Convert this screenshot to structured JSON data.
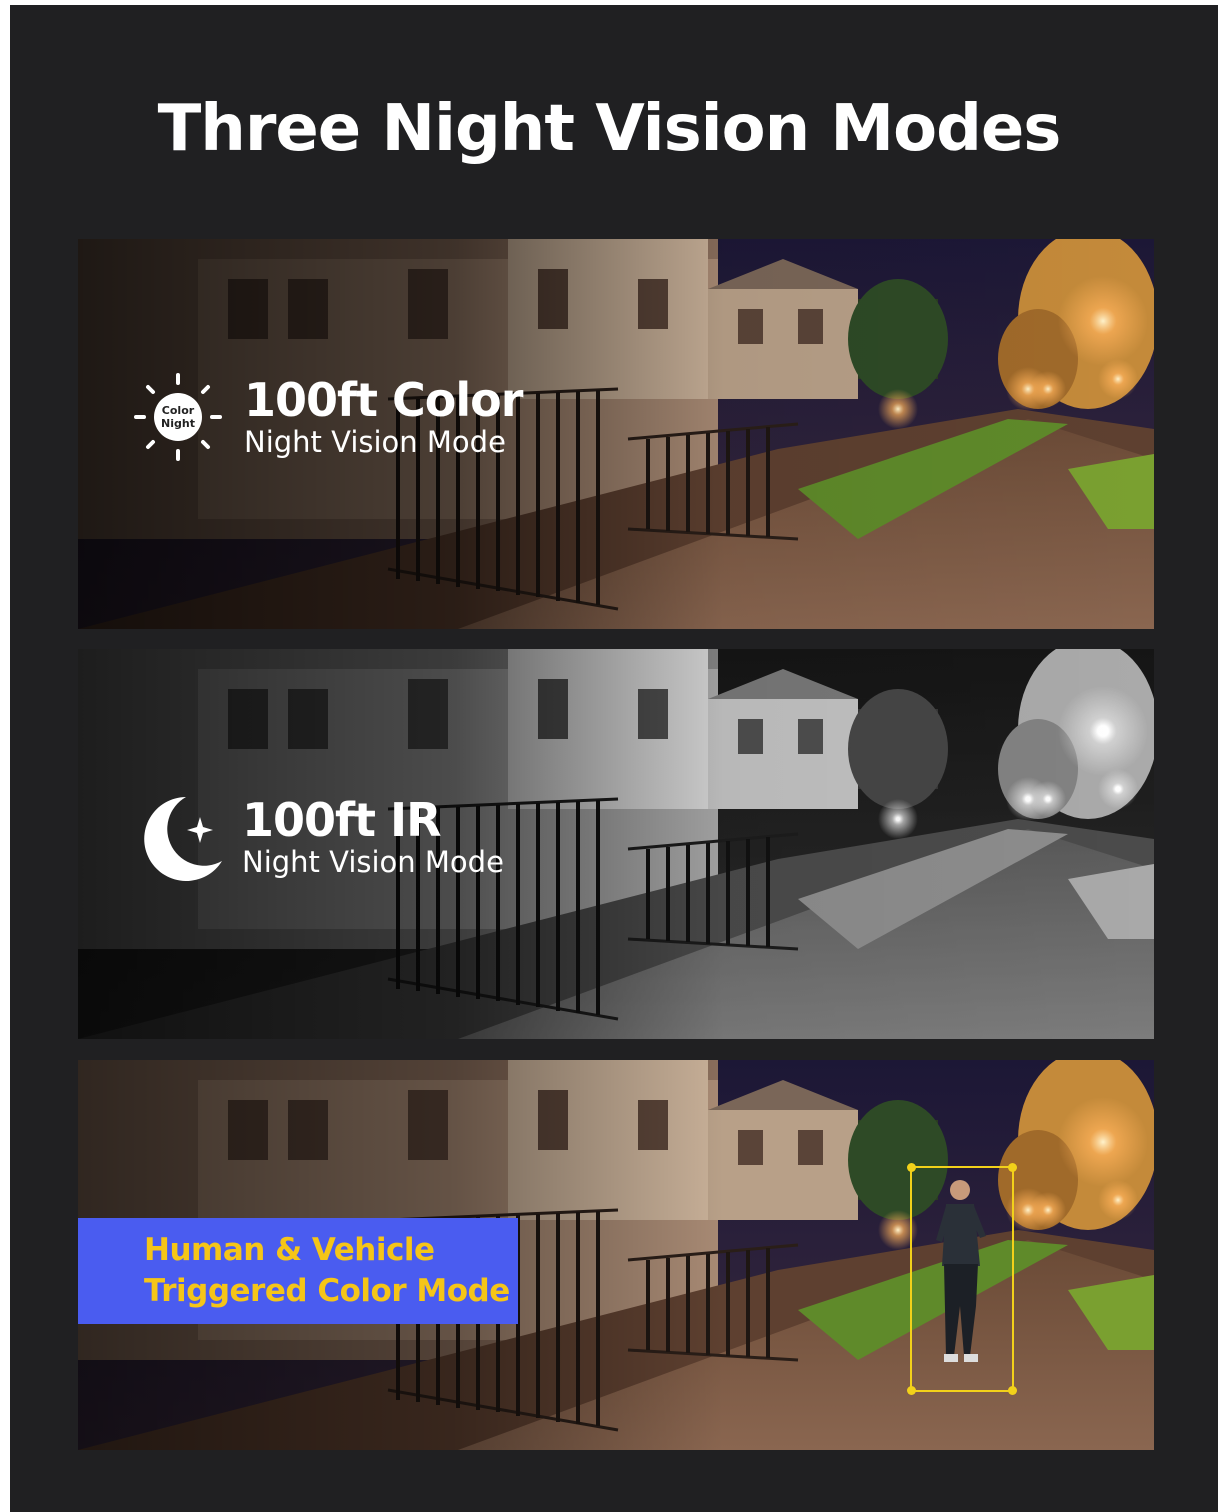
{
  "title": "Three Night Vision Modes",
  "panels": [
    {
      "mode": "color",
      "heading": "100ft Color",
      "subheading": "Night Vision Mode",
      "icon": "color-night-sun-icon",
      "icon_text_line1": "Color",
      "icon_text_line2": "Night"
    },
    {
      "mode": "ir",
      "heading": "100ft IR",
      "subheading": "Night Vision Mode",
      "icon": "moon-star-icon"
    },
    {
      "mode": "triggered",
      "badge_line1": "Human & Vehicle",
      "badge_line2": "Triggered Color Mode",
      "badge_color": "#4a5cf0",
      "badge_text_color": "#f5c518",
      "detection_box_color": "#f2d11a"
    }
  ]
}
